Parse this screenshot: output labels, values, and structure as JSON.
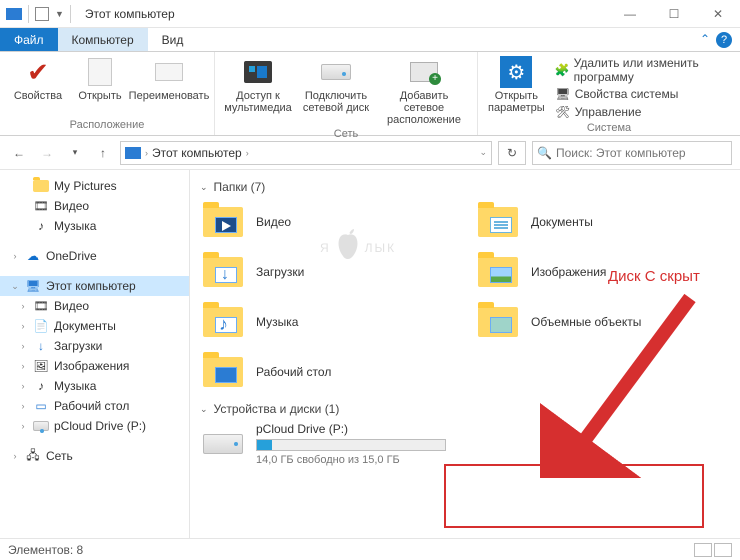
{
  "window": {
    "title": "Этот компьютер"
  },
  "tabs": {
    "file": "Файл",
    "computer": "Компьютер",
    "view": "Вид"
  },
  "ribbon": {
    "location": {
      "caption": "Расположение",
      "properties": "Свойства",
      "open": "Открыть",
      "rename": "Переименовать"
    },
    "network": {
      "caption": "Сеть",
      "media": "Доступ к мультимедиа",
      "map_drive": "Подключить сетевой диск",
      "add_location": "Добавить сетевое расположение"
    },
    "system": {
      "caption": "Система",
      "settings": "Открыть параметры",
      "uninstall": "Удалить или изменить программу",
      "sys_props": "Свойства системы",
      "manage": "Управление"
    }
  },
  "address": {
    "crumb": "Этот компьютер"
  },
  "search": {
    "placeholder": "Поиск: Этот компьютер"
  },
  "sidebar": {
    "pictures": "My Pictures",
    "video": "Видео",
    "music": "Музыка",
    "onedrive": "OneDrive",
    "this_pc": "Этот компьютер",
    "sub": {
      "video": "Видео",
      "documents": "Документы",
      "downloads": "Загрузки",
      "images": "Изображения",
      "music": "Музыка",
      "desktop": "Рабочий стол",
      "pcloud": "pCloud Drive (P:)"
    },
    "network": "Сеть"
  },
  "content": {
    "folders_header": "Папки (7)",
    "devices_header": "Устройства и диски (1)",
    "items": {
      "video": "Видео",
      "documents": "Документы",
      "downloads": "Загрузки",
      "images": "Изображения",
      "music": "Музыка",
      "objects3d": "Объемные объекты",
      "desktop": "Рабочий стол"
    },
    "drive": {
      "name": "pCloud Drive (P:)",
      "free": "14,0 ГБ свободно из 15,0 ГБ"
    }
  },
  "status": {
    "items": "Элементов: 8"
  },
  "annotation": {
    "label": "Диск С скрыт"
  },
  "watermark": {
    "left": "Я",
    "right": "ЛЫК"
  }
}
